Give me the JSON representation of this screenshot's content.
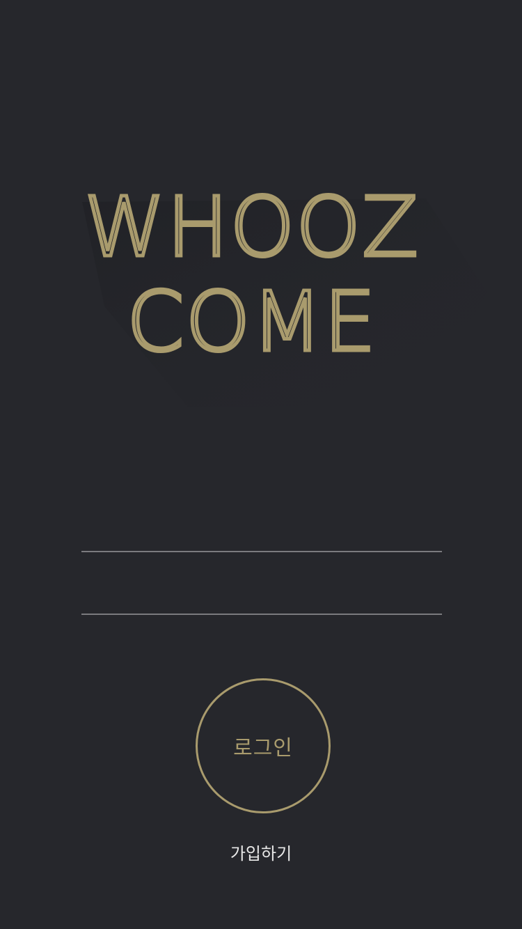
{
  "logo": {
    "line1": "WHOOZ",
    "line2": "COME",
    "color": "#a99b6d"
  },
  "form": {
    "username_value": "",
    "password_value": ""
  },
  "login_button": {
    "label": "로그인"
  },
  "signup_link": {
    "label": "가입하기"
  },
  "colors": {
    "background": "#26272c",
    "accent": "#a99b6d",
    "field_underline": "#7b7b7f",
    "link_text": "#e8e8e8"
  }
}
